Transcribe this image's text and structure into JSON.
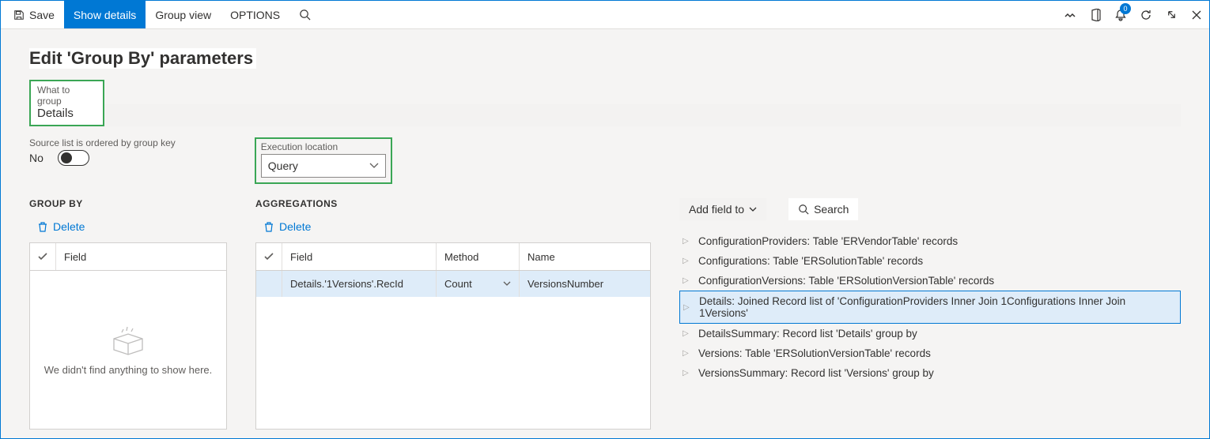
{
  "commandbar": {
    "save": "Save",
    "show_details": "Show details",
    "group_view": "Group view",
    "options": "OPTIONS"
  },
  "notification_count": "0",
  "page": {
    "title": "Edit 'Group By' parameters",
    "what_to_group_label": "What to group",
    "what_to_group_value": "Details",
    "source_ordered_label": "Source list is ordered by group key",
    "source_ordered_value": "No",
    "execution_location_label": "Execution location",
    "execution_location_value": "Query"
  },
  "groupby": {
    "title": "GROUP BY",
    "delete": "Delete",
    "field_header": "Field",
    "empty_message": "We didn't find anything to show here."
  },
  "aggregations": {
    "title": "AGGREGATIONS",
    "delete": "Delete",
    "headers": {
      "field": "Field",
      "method": "Method",
      "name": "Name"
    },
    "rows": [
      {
        "field": "Details.'1Versions'.RecId",
        "method": "Count",
        "name": "VersionsNumber"
      }
    ]
  },
  "rightpane": {
    "add_field": "Add field to",
    "search": "Search",
    "tree": [
      "ConfigurationProviders: Table 'ERVendorTable' records",
      "Configurations: Table 'ERSolutionTable' records",
      "ConfigurationVersions: Table 'ERSolutionVersionTable' records",
      "Details: Joined Record list of 'ConfigurationProviders Inner Join 1Configurations Inner Join 1Versions'",
      "DetailsSummary: Record list 'Details' group by",
      "Versions: Table 'ERSolutionVersionTable' records",
      "VersionsSummary: Record list 'Versions' group by"
    ],
    "selected_index": 3
  }
}
